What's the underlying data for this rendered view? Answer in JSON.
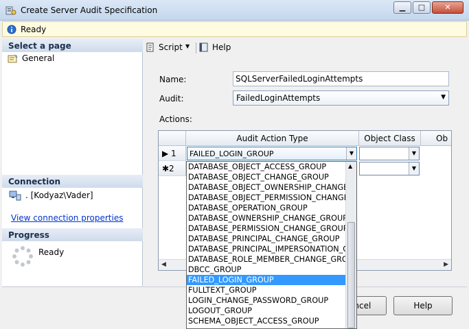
{
  "window": {
    "title": "Create Server Audit Specification",
    "minimize_glyph": "▁",
    "maximize_glyph": "□",
    "close_glyph": "✕"
  },
  "status": {
    "text": "Ready"
  },
  "sidebar": {
    "select_page_header": "Select a page",
    "pages": [
      {
        "label": "General",
        "icon": "properties-page-icon"
      }
    ],
    "connection_header": "Connection",
    "connection_server": ". [Kodyaz\\Vader]",
    "connection_link": "View connection properties",
    "progress_header": "Progress",
    "progress_status": "Ready"
  },
  "toolbar": {
    "script_label": "Script",
    "script_caret": "▼",
    "help_label": "Help"
  },
  "form": {
    "name_label": "Name:",
    "name_value": "SQLServerFailedLoginAttempts",
    "audit_label": "Audit:",
    "audit_value": "FailedLoginAttempts",
    "actions_label": "Actions:"
  },
  "grid": {
    "columns": [
      "Audit Action Type",
      "Object Class",
      "Ob"
    ],
    "rows": [
      {
        "marker": "▶ 1",
        "action": "FAILED_LOGIN_GROUP"
      },
      {
        "marker": "✱2",
        "action": ""
      }
    ],
    "scroll_left": "◀",
    "scroll_right": "▶"
  },
  "dropdown": {
    "items": [
      "DATABASE_OBJECT_ACCESS_GROUP",
      "DATABASE_OBJECT_CHANGE_GROUP",
      "DATABASE_OBJECT_OWNERSHIP_CHANGE_GROUP",
      "DATABASE_OBJECT_PERMISSION_CHANGE_GROUP",
      "DATABASE_OPERATION_GROUP",
      "DATABASE_OWNERSHIP_CHANGE_GROUP",
      "DATABASE_PERMISSION_CHANGE_GROUP",
      "DATABASE_PRINCIPAL_CHANGE_GROUP",
      "DATABASE_PRINCIPAL_IMPERSONATION_GROUP",
      "DATABASE_ROLE_MEMBER_CHANGE_GROUP",
      "DBCC_GROUP",
      "FAILED_LOGIN_GROUP",
      "FULLTEXT_GROUP",
      "LOGIN_CHANGE_PASSWORD_GROUP",
      "LOGOUT_GROUP",
      "SCHEMA_OBJECT_ACCESS_GROUP"
    ],
    "selected_index": 11,
    "scroll_up": "▲"
  },
  "buttons": {
    "cancel_label": "Cancel",
    "help_label": "Help"
  },
  "colors": {
    "selection": "#3399ff",
    "status_background": "#fffbe0",
    "link": "#0033cc"
  }
}
